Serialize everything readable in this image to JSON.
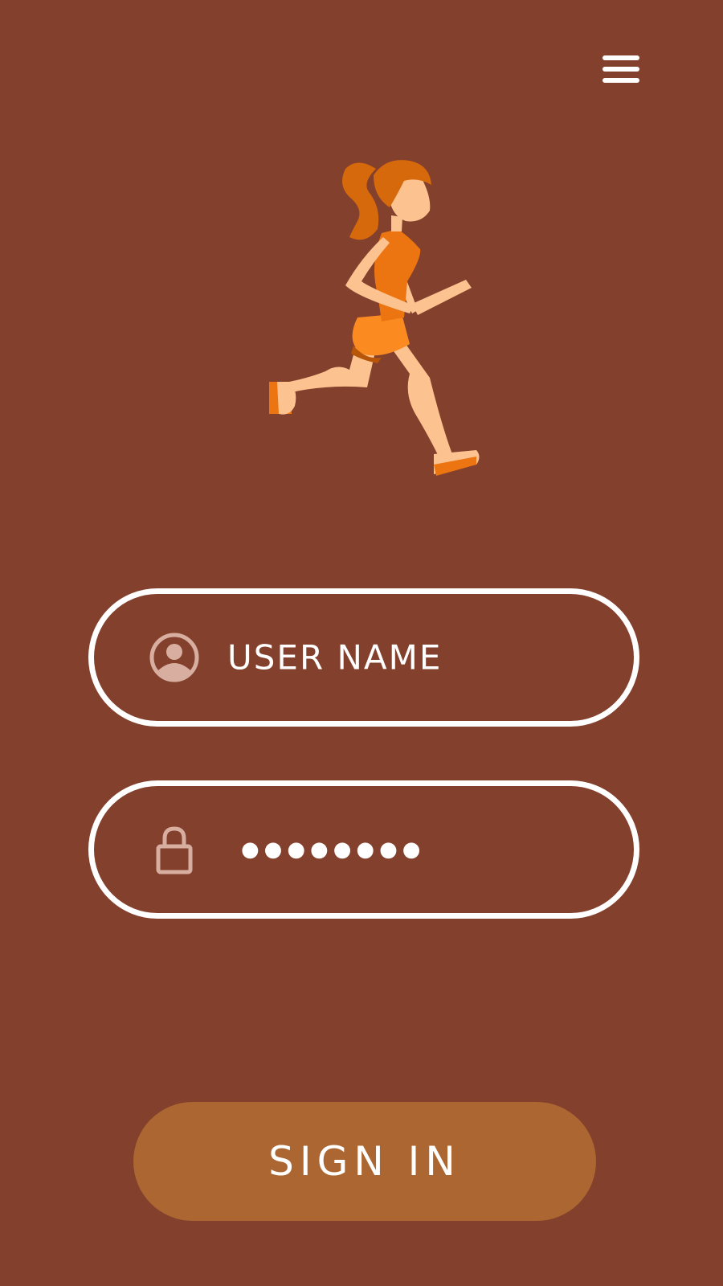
{
  "colors": {
    "background": "#83402c",
    "field_border": "#ffffff",
    "button": "#ac6631",
    "icon_muted": "#d7aea0"
  },
  "header": {
    "menu_icon": "hamburger-menu-icon"
  },
  "illustration": {
    "icon": "running-woman-illustration"
  },
  "form": {
    "username": {
      "icon": "user-icon",
      "placeholder": "USER NAME"
    },
    "password": {
      "icon": "lock-icon",
      "masked_value": "●●●●●●●●"
    },
    "sign_in_label": "SIGN IN"
  }
}
